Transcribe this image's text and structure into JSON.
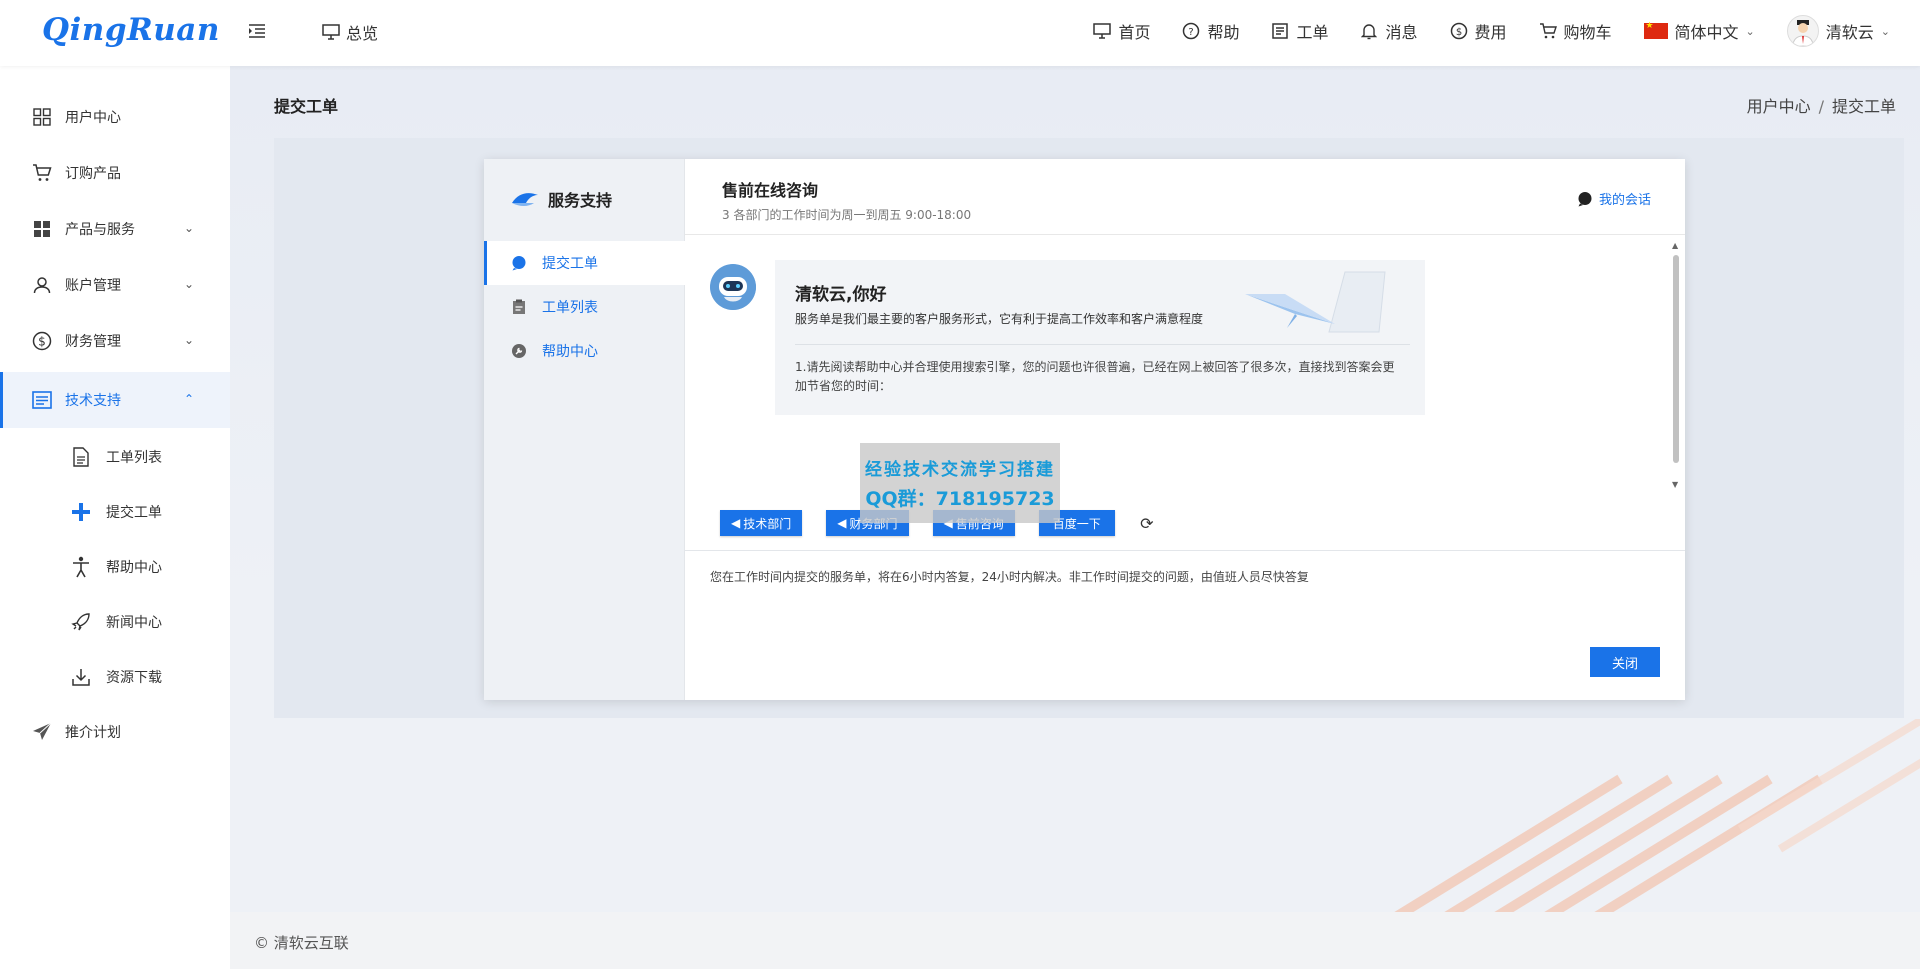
{
  "brand": {
    "logo_text": "QingRuan"
  },
  "topbar": {
    "overview_label": "总览",
    "nav": [
      {
        "label": "首页",
        "icon": "monitor-icon"
      },
      {
        "label": "帮助",
        "icon": "help-circle-icon"
      },
      {
        "label": "工单",
        "icon": "document-icon"
      },
      {
        "label": "消息",
        "icon": "bell-icon"
      },
      {
        "label": "费用",
        "icon": "dollar-icon"
      },
      {
        "label": "购物车",
        "icon": "cart-icon"
      }
    ],
    "language": "简体中文",
    "user_name": "清软云"
  },
  "sidebar": {
    "items": [
      {
        "label": "用户中心",
        "icon": "grid-icon"
      },
      {
        "label": "订购产品",
        "icon": "cart-icon"
      },
      {
        "label": "产品与服务",
        "icon": "apps-icon"
      },
      {
        "label": "账户管理",
        "icon": "user-icon"
      },
      {
        "label": "财务管理",
        "icon": "dollar-icon"
      },
      {
        "label": "技术支持",
        "icon": "list-icon"
      },
      {
        "label": "推介计划",
        "icon": "paper-plane-icon"
      }
    ],
    "sub_items": [
      {
        "label": "工单列表",
        "icon": "file-icon"
      },
      {
        "label": "提交工单",
        "icon": "plus-icon"
      },
      {
        "label": "帮助中心",
        "icon": "person-icon"
      },
      {
        "label": "新闻中心",
        "icon": "rocket-icon"
      },
      {
        "label": "资源下载",
        "icon": "download-icon"
      }
    ]
  },
  "page": {
    "title": "提交工单",
    "breadcrumb": [
      "用户中心",
      "提交工单"
    ],
    "footer": "© 清软云互联"
  },
  "dialog": {
    "brand": "服务支持",
    "nav": [
      "提交工单",
      "工单列表",
      "帮助中心"
    ],
    "title": "售前在线咨询",
    "subtitle": "3 各部门的工作时间为周一到周五 9:00-18:00",
    "my_chat": "我的会话",
    "greeting": "清软云,你好",
    "greeting_desc": "服务单是我们最主要的客户服务形式，它有利于提高工作效率和客户满意程度",
    "tip": "1.请先阅读帮助中心并合理使用搜索引擎，您的问题也许很普遍，已经在网上被回答了很多次，直接找到答案会更加节省您的时间：",
    "quick_buttons": [
      "技术部门",
      "财务部门",
      "售前咨询",
      "百度一下"
    ],
    "notice": "您在工作时间内提交的服务单，将在6小时内答复，24小时内解决。非工作时间提交的问题，由值班人员尽快答复",
    "close_label": "关闭"
  },
  "watermark": {
    "line1": "经验技术交流学习搭建",
    "line2": "QQ群：718195723"
  },
  "colors": {
    "accent": "#1a73e8",
    "sidebar_active_bg": "#eef3fb"
  }
}
